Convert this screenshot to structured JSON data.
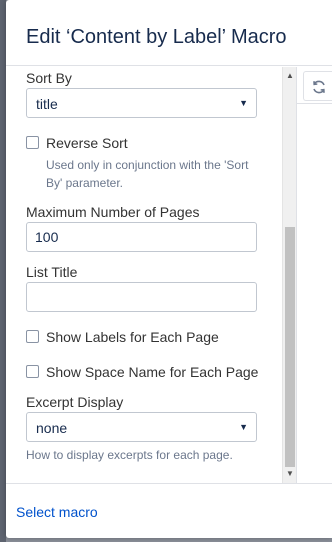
{
  "dialog": {
    "title": "Edit ‘Content by Label’ Macro"
  },
  "form": {
    "sort_by": {
      "label": "Sort By",
      "value": "title",
      "caret": "▼"
    },
    "reverse_sort": {
      "label": "Reverse Sort",
      "checked": false,
      "help_line1": "Used only in conjunction with the 'Sort",
      "help_line2": "By' parameter."
    },
    "max_pages": {
      "label": "Maximum Number of Pages",
      "value": "100"
    },
    "list_title": {
      "label": "List Title",
      "value": ""
    },
    "show_labels": {
      "label": "Show Labels for Each Page",
      "checked": false
    },
    "show_space_name": {
      "label": "Show Space Name for Each Page",
      "checked": false
    },
    "excerpt_display": {
      "label": "Excerpt Display",
      "value": "none",
      "caret": "▼",
      "help": "How to display excerpts for each page."
    }
  },
  "scrollbar": {
    "up_arrow": "▲",
    "down_arrow": "▼"
  },
  "preview": {
    "refresh_icon": "refresh-icon"
  },
  "footer": {
    "select_macro_link": "Select macro"
  },
  "colors": {
    "link": "#0052cc",
    "title": "#172b4d",
    "help_text": "#6b778c",
    "border": "#c1c7d0"
  }
}
